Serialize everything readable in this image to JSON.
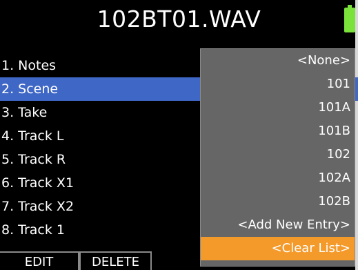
{
  "header": {
    "title": "102BT01.WAV"
  },
  "metadata_fields": [
    {
      "label": "1. Notes"
    },
    {
      "label": "2. Scene"
    },
    {
      "label": "3. Take"
    },
    {
      "label": "4. Track L"
    },
    {
      "label": "5. Track R"
    },
    {
      "label": "6. Track X1"
    },
    {
      "label": "7. Track X2"
    },
    {
      "label": "8. Track 1"
    }
  ],
  "selected_field_index": 1,
  "dropdown": {
    "options": [
      "<None>",
      "101",
      "101A",
      "101B",
      "102",
      "102A",
      "102B",
      "<Add New Entry>",
      "<Clear List>"
    ],
    "highlighted_index": 8
  },
  "bottom_bar": {
    "edit_label": "EDIT",
    "delete_label": "DELETE"
  },
  "colors": {
    "background": "#000000",
    "selection_blue": "#3f67c6",
    "dropdown_gray": "#666666",
    "highlight_orange": "#f49a2b",
    "battery_green": "#7be23c"
  },
  "icons": {
    "battery": "battery-icon"
  }
}
